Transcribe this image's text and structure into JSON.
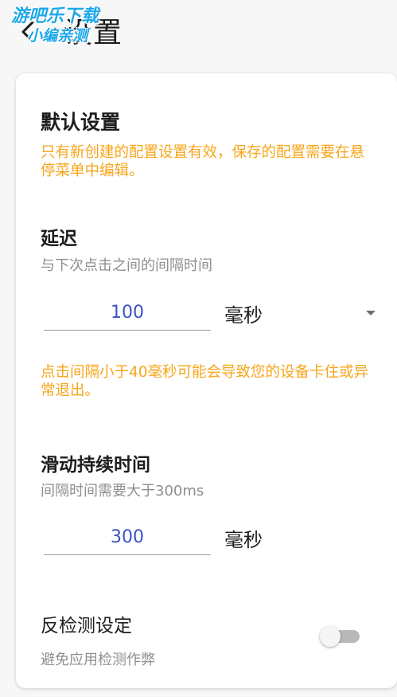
{
  "header": {
    "back_icon": "chevron-left-icon",
    "title": "设置",
    "watermark_line1": "游吧乐下载",
    "watermark_line2": "小编亲测"
  },
  "default_section": {
    "title": "默认设置",
    "warning": "只有新创建的配置设置有效，保存的配置需要在悬停菜单中编辑。"
  },
  "delay": {
    "title": "延迟",
    "description": "与下次点击之间的间隔时间",
    "value": "100",
    "unit": "毫秒",
    "warning": "点击间隔小于40毫秒可能会导致您的设备卡住或异常退出。"
  },
  "swipe_duration": {
    "title": "滑动持续时间",
    "description": "间隔时间需要大于300ms",
    "value": "300",
    "unit": "毫秒"
  },
  "anti_detection": {
    "title": "反检测设定",
    "description": "避免应用检测作弊",
    "enabled": false
  },
  "colors": {
    "warning": "#f7a51a",
    "input_value": "#3d52c7",
    "watermark": "#1ea8e8",
    "card_bg": "#ffffff"
  }
}
